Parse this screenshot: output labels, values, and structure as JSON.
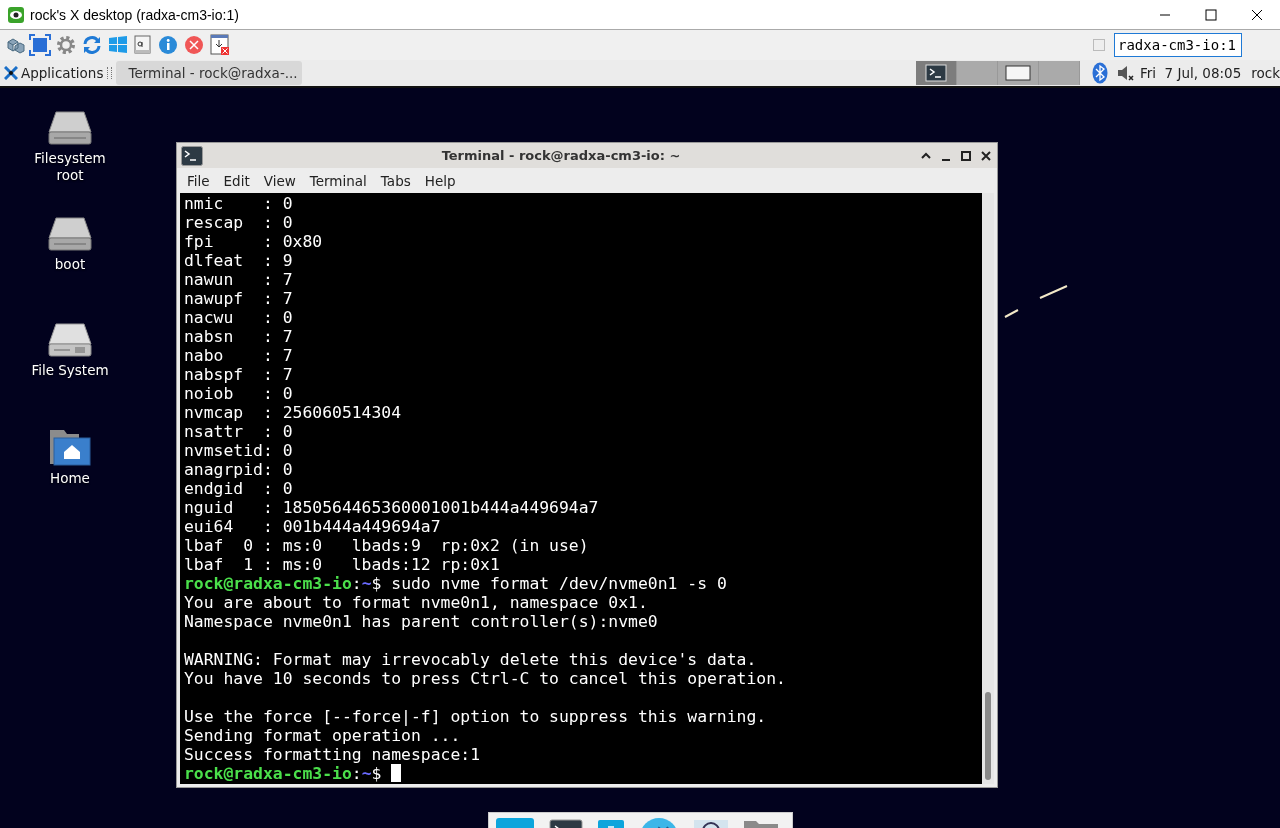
{
  "window": {
    "title": "rock's X desktop (radxa-cm3-io:1)"
  },
  "toolbar": {
    "checkbox": {
      "checked": false
    },
    "host_field": {
      "value": "radxa-cm3-io:1"
    }
  },
  "panel": {
    "applications": "Applications",
    "tasks": [
      {
        "label": "Terminal - rock@radxa-...",
        "selected": true
      }
    ],
    "workspaces": [
      {
        "selected": true,
        "kind": "terminal"
      },
      {
        "selected": false,
        "kind": "empty"
      },
      {
        "selected": false,
        "kind": "window"
      },
      {
        "selected": false,
        "kind": "empty"
      }
    ],
    "clock": "Fri  7 Jul, 08:05",
    "user": "rock"
  },
  "desktop_icons": [
    {
      "label": "Filesystem root",
      "kind": "drive"
    },
    {
      "label": "boot",
      "kind": "drive"
    },
    {
      "label": "File System",
      "kind": "disk"
    },
    {
      "label": "Home",
      "kind": "home"
    }
  ],
  "terminal": {
    "title": "Terminal - rock@radxa-cm3-io: ~",
    "menu": [
      "File",
      "Edit",
      "View",
      "Terminal",
      "Tabs",
      "Help"
    ],
    "lines": [
      {
        "kind": "output",
        "text": "nmic    : 0"
      },
      {
        "kind": "output",
        "text": "rescap  : 0"
      },
      {
        "kind": "output",
        "text": "fpi     : 0x80"
      },
      {
        "kind": "output",
        "text": "dlfeat  : 9"
      },
      {
        "kind": "output",
        "text": "nawun   : 7"
      },
      {
        "kind": "output",
        "text": "nawupf  : 7"
      },
      {
        "kind": "output",
        "text": "nacwu   : 0"
      },
      {
        "kind": "output",
        "text": "nabsn   : 7"
      },
      {
        "kind": "output",
        "text": "nabo    : 7"
      },
      {
        "kind": "output",
        "text": "nabspf  : 7"
      },
      {
        "kind": "output",
        "text": "noiob   : 0"
      },
      {
        "kind": "output",
        "text": "nvmcap  : 256060514304"
      },
      {
        "kind": "output",
        "text": "nsattr  : 0"
      },
      {
        "kind": "output",
        "text": "nvmsetid: 0"
      },
      {
        "kind": "output",
        "text": "anagrpid: 0"
      },
      {
        "kind": "output",
        "text": "endgid  : 0"
      },
      {
        "kind": "output",
        "text": "nguid   : 1850564465360001001b444a449694a7"
      },
      {
        "kind": "output",
        "text": "eui64   : 001b444a449694a7"
      },
      {
        "kind": "output",
        "text": "lbaf  0 : ms:0   lbads:9  rp:0x2 (in use)"
      },
      {
        "kind": "output",
        "text": "lbaf  1 : ms:0   lbads:12 rp:0x1"
      },
      {
        "kind": "prompt",
        "host": "rock@radxa-cm3-io",
        "colon": ":",
        "path": "~",
        "sign": "$",
        "command": "sudo nvme format /dev/nvme0n1 -s 0"
      },
      {
        "kind": "output",
        "text": "You are about to format nvme0n1, namespace 0x1."
      },
      {
        "kind": "output",
        "text": "Namespace nvme0n1 has parent controller(s):nvme0"
      },
      {
        "kind": "blank"
      },
      {
        "kind": "output",
        "text": "WARNING: Format may irrevocably delete this device's data."
      },
      {
        "kind": "output",
        "text": "You have 10 seconds to press Ctrl-C to cancel this operation."
      },
      {
        "kind": "blank"
      },
      {
        "kind": "output",
        "text": "Use the force [--force|-f] option to suppress this warning."
      },
      {
        "kind": "output",
        "text": "Sending format operation ..."
      },
      {
        "kind": "output",
        "text": "Success formatting namespace:1"
      },
      {
        "kind": "prompt",
        "host": "rock@radxa-cm3-io",
        "colon": ":",
        "path": "~",
        "sign": "$",
        "cursor": true
      }
    ]
  }
}
